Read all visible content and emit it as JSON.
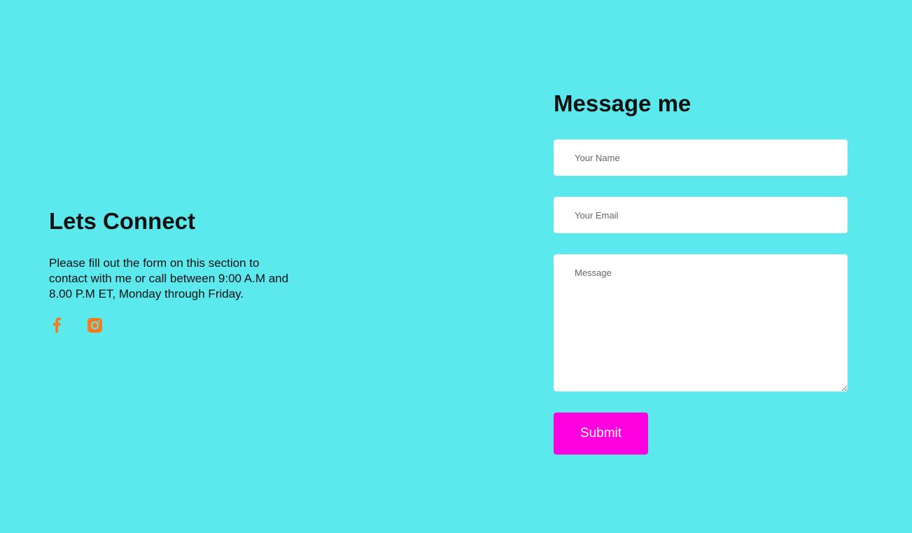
{
  "colors": {
    "background": "#5be9ee",
    "submit_button": "#ff00e0",
    "social_icons": "#f57a1f",
    "heading_text": "#111111"
  },
  "connect": {
    "title": "Lets Connect",
    "description": "Please fill out the form on this section to contact with me or call between 9:00 A.M and 8.00 P.M ET, Monday through Friday."
  },
  "social": [
    {
      "icon": "facebook-icon"
    },
    {
      "icon": "instagram-icon"
    }
  ],
  "form": {
    "title": "Message me",
    "name_placeholder": "Your Name",
    "email_placeholder": "Your Email",
    "message_placeholder": "Message",
    "submit_label": "Submit"
  }
}
